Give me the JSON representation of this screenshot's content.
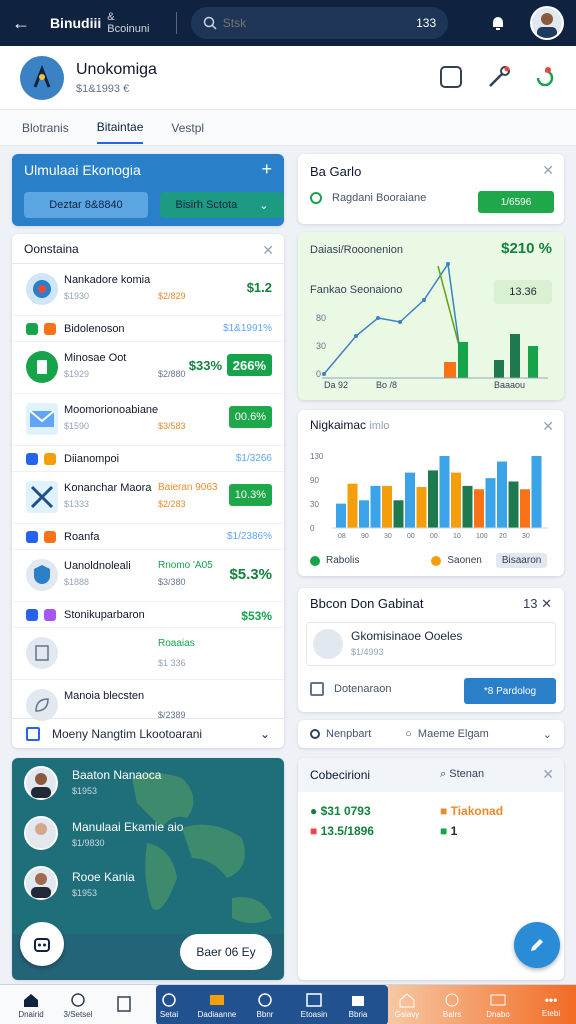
{
  "topbar": {
    "app_title": "Binudiii",
    "app_sub": "& Bcoinuni",
    "search_placeholder": "Stsk",
    "search_count": "133"
  },
  "header": {
    "name": "Unokomiga",
    "sub": "$1&1993 €"
  },
  "tabs": [
    {
      "label": "Blotranis"
    },
    {
      "label": "Bitaintae"
    },
    {
      "label": "Vestpl"
    }
  ],
  "sim": {
    "title": "Ulmulaai Ekonogia",
    "btn1": "Deztar 8&8840",
    "btn2": "Bisirh Sctota"
  },
  "list": {
    "header": "Oonstaina",
    "rows": [
      {
        "title": "Nankadore komia",
        "sub": "$1930",
        "sub2": "$2/829",
        "value": "$1.2"
      },
      {
        "title": "Bidolenoson",
        "value": "$1&1991%"
      },
      {
        "title": "Minosae Oot",
        "sub": "$1929",
        "sub2": "$2/880",
        "value": "$33%",
        "pill": "266%"
      },
      {
        "title": "Moomorionoabiane",
        "sub": "$1590",
        "sub2": "$3/583",
        "pill": "00.6%"
      },
      {
        "title": "Diianompoi",
        "value": "$1/3266"
      },
      {
        "title": "Konanchar Maora",
        "sub": "$1333",
        "sub2": "$2/283",
        "gl": "Baieran 9063",
        "pill": "10.3%"
      },
      {
        "title": "Roanfa",
        "value": "$1/2386%"
      },
      {
        "title": "Uanoldnoleali",
        "sub": "$1888",
        "sub2": "$3/380",
        "gl": "Rnomo 'A05",
        "value": "$5.3%"
      },
      {
        "title": "Stonikuparbaron",
        "value": "$53%"
      },
      {
        "title": "",
        "sub": "",
        "sub2": "$1 336",
        "gl": "Roaaias"
      },
      {
        "title": "Manoia blecsten",
        "sub": "",
        "sub2": "$/2389"
      }
    ],
    "footer": "Moeny Nangtim Lkootoarani"
  },
  "map": {
    "users": [
      {
        "name": "Baaton Nanaoca",
        "sub": "$1953"
      },
      {
        "name": "Manulaai Ekamie aio",
        "sub": "$1/9830"
      },
      {
        "name": "Rooe Kania",
        "sub": "$1953"
      }
    ],
    "button": "Baer 06 Ey"
  },
  "bc": {
    "title": "Ba Garlo",
    "row_label": "Ragdani Booraiane",
    "btn": "1/6596"
  },
  "line": {
    "h1": "Daiasi/Rooonenion",
    "v1": "$210 %",
    "h2": "Fankao Seonaiono",
    "v2": "13.36",
    "chart_data": {
      "type": "line",
      "y_ticks": [
        "80",
        "30",
        "0"
      ],
      "x_labels": [
        "Da 92",
        "Bo /8",
        "Baaaou"
      ]
    }
  },
  "bar": {
    "title": "Nigkaimac",
    "title_sub": "imlo",
    "legend": [
      "Rabolis",
      "Saonen",
      "Bisaaron"
    ],
    "chart_data": {
      "type": "bar",
      "y_ticks": [
        "130",
        "90",
        "30",
        "0"
      ],
      "x_labels": [
        "08",
        "90",
        "30",
        "00",
        "00",
        "10",
        "100",
        "20",
        "30"
      ],
      "values": [
        22,
        40,
        25,
        38,
        38,
        25,
        50,
        37,
        52,
        65,
        50,
        38,
        35,
        45,
        60,
        42,
        35,
        65
      ]
    }
  },
  "be": {
    "title": "Bbcon Don Gabinat",
    "count": "13",
    "inner_title": "Gkomisinaoe Ooeles",
    "inner_sub": "$1/4993",
    "label": "Dotenaraon",
    "btn": "*8 Pardolog"
  },
  "seg": {
    "a": "Nenpbart",
    "b": "Maeme Elgam"
  },
  "col": {
    "title": "Cobecirioni",
    "search": "Stenan",
    "t1": "$31 0793",
    "t2": "Tiakonad",
    "t3": "13.5/1896",
    "t4": "1"
  },
  "bottom": [
    "Dnairid",
    "3/Setsel",
    "",
    "Setai",
    "Dadiaanne",
    "Bbnr",
    "Etoasin",
    "Bbria",
    "Gsiavy",
    "Balrs",
    "Dnabo",
    "Etebi"
  ]
}
